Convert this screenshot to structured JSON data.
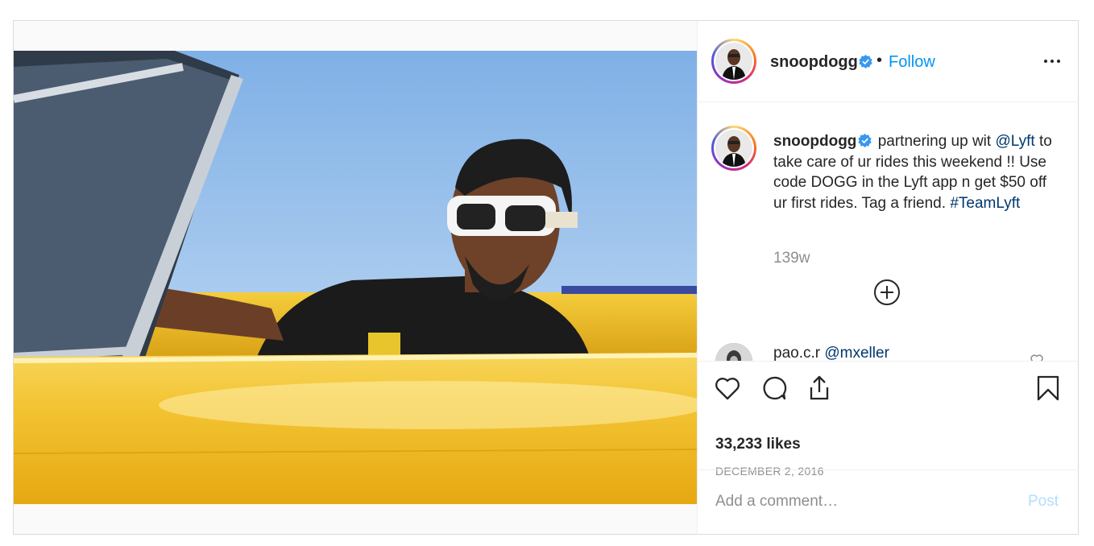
{
  "header": {
    "username": "snoopdogg",
    "separator": "•",
    "follow_label": "Follow",
    "more_icon": "more-horizontal-icon"
  },
  "caption": {
    "username": "snoopdogg",
    "text_1": " partnering up wit ",
    "mention": "@Lyft",
    "text_2": " to take care of ur rides this weekend !! Use code DOGG in the Lyft app n get $50 off ur first rides. Tag a friend. ",
    "hashtag": "#TeamLyft",
    "timestamp": "139w"
  },
  "reply": {
    "username": "pao.c.r",
    "mention": "@mxeller"
  },
  "actions": {
    "likes": "33,233 likes",
    "date": "DECEMBER 2, 2016"
  },
  "comment_box": {
    "placeholder": "Add a comment…",
    "post_label": "Post"
  },
  "colors": {
    "accent": "#0095f6",
    "verified": "#3897f0",
    "car_yellow": "#f2c12e"
  }
}
